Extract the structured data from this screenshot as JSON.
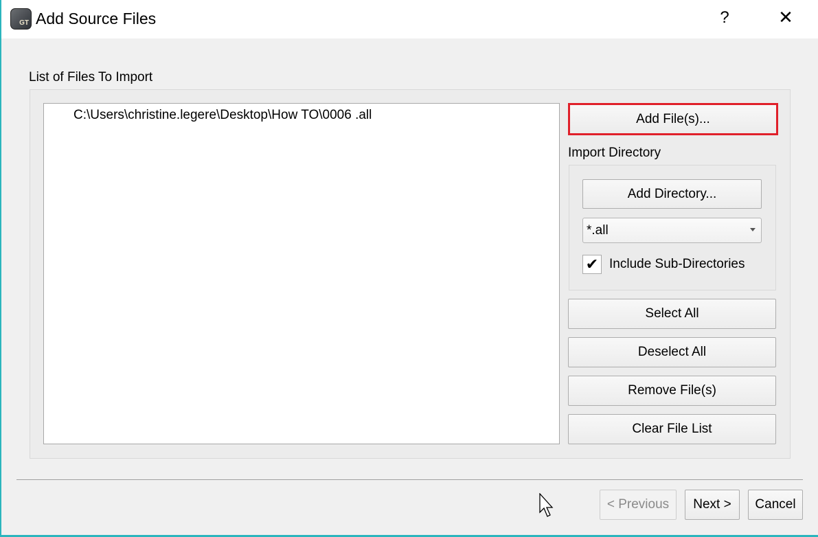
{
  "window": {
    "title": "Add Source Files",
    "help": "?",
    "close": "✕"
  },
  "group": {
    "label": "List of Files To Import"
  },
  "files": [
    "C:\\Users\\christine.legere\\Desktop\\How TO\\0006 .all"
  ],
  "buttons": {
    "add_files": "Add File(s)...",
    "select_all": "Select All",
    "deselect_all": "Deselect All",
    "remove_files": "Remove File(s)",
    "clear_list": "Clear File List"
  },
  "import_directory": {
    "label": "Import Directory",
    "add_directory": "Add Directory...",
    "filter_value": "*.all",
    "include_sub_label": "Include Sub-Directories",
    "include_sub_checked": true,
    "check_glyph": "✔"
  },
  "footer": {
    "previous": "< Previous",
    "next": "Next >",
    "cancel": "Cancel"
  },
  "colors": {
    "highlight": "#e0202a",
    "accent_border": "#2bb5bd"
  }
}
